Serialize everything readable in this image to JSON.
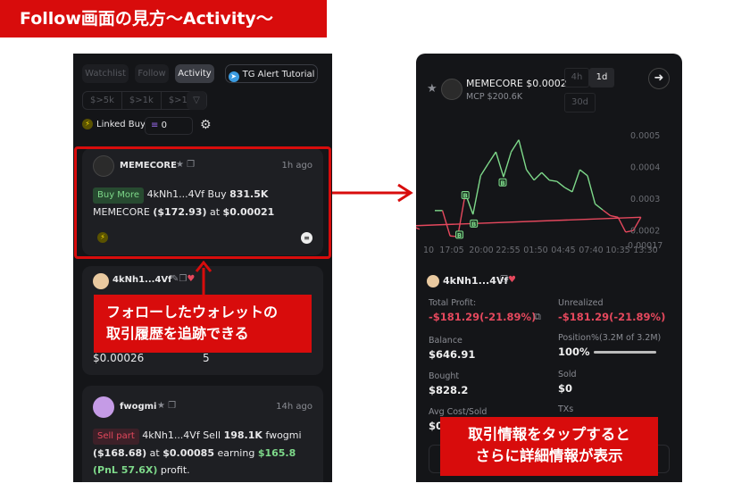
{
  "banner": {
    "title": "Follow画面の見方〜Activity〜"
  },
  "left": {
    "tabs": [
      {
        "label": "Watchlist"
      },
      {
        "label": "Follow"
      },
      {
        "label": "Activity",
        "active": true
      }
    ],
    "tg_button": "TG Alert Tutorial",
    "filters": [
      "$>5k",
      "$>1k",
      "$>100"
    ],
    "linked_buy": "Linked Buy",
    "amount_value": "0",
    "cards": [
      {
        "token": "MEMECORE",
        "time": "1h ago",
        "badge": "Buy More",
        "wallet": "4kNh1...4Vf",
        "action": "Buy",
        "amount": "831.5K",
        "token_sym": "MEMECORE",
        "usd": "($172.93)",
        "at": "at",
        "price": "$0.00021"
      },
      {
        "wallet": "4kNh1...4Vf",
        "price": "$0.00026",
        "count": "5"
      },
      {
        "token": "fwogmi",
        "time": "14h ago",
        "badge": "Sell part",
        "wallet": "4kNh1...4Vf",
        "action": "Sell",
        "amount": "198.1K",
        "token_sym": "fwogmi",
        "usd": "($168.68)",
        "at": "at",
        "price": "$0.00085",
        "earning": "earning",
        "profit": "$165.8 (PnL 57.6X)",
        "suffix": "profit."
      }
    ],
    "callout": [
      "フォローしたウォレットの",
      "取引履歴を追跡できる"
    ]
  },
  "right": {
    "token_title": "MEMECORE $0.0002",
    "mcp": "MCP $200.6K",
    "timeframes": [
      "4h",
      "1d",
      "30d"
    ],
    "active_timeframe": "1d",
    "wallet": "4kNh1...4Vf",
    "stats": {
      "total_profit_label": "Total Profit:",
      "total_profit": "-$181.29(-21.89%)",
      "unrealized_label": "Unrealized",
      "unrealized": "-$181.29(-21.89%)",
      "balance_label": "Balance",
      "balance": "$646.91",
      "position_label": "Position%(3.2M of 3.2M)",
      "position": "100%",
      "position_fraction": 1.0,
      "bought_label": "Bought",
      "bought": "$828.2",
      "sold_label": "Sold",
      "sold": "$0",
      "avg_label": "Avg Cost/Sold",
      "avg": "$0",
      "txs_label": "TXs"
    },
    "callout": [
      "取引情報をタップすると",
      "さらに詳細情報が表示"
    ]
  },
  "colors": {
    "accent_red": "#d80c0c",
    "up": "#7ed98a",
    "down": "#e5485d",
    "panel": "#141518"
  },
  "chart_data": {
    "type": "line",
    "y_ticks": [
      "0.0005",
      "0.0004",
      "0.0003",
      "0.0002",
      "0.00017"
    ],
    "x_ticks": [
      "10",
      "17:05",
      "20:00",
      "22:55",
      "01:50",
      "04:45",
      "07:40",
      "10:35",
      "13:30"
    ],
    "ylim": [
      0.00015,
      0.00055
    ],
    "points": [
      [
        "15:25",
        0.000261
      ],
      [
        "16:10",
        0.000261
      ],
      [
        "16:55",
        0.000181
      ],
      [
        "17:40",
        0.000179
      ],
      [
        "18:25",
        0.000315
      ],
      [
        "19:10",
        0.000249
      ],
      [
        "19:55",
        0.000371
      ],
      [
        "20:40",
        0.000409
      ],
      [
        "21:25",
        0.000446
      ],
      [
        "22:10",
        0.000367
      ],
      [
        "22:55",
        0.000446
      ],
      [
        "23:40",
        0.000484
      ],
      [
        "00:25",
        0.00039
      ],
      [
        "01:10",
        0.000357
      ],
      [
        "01:55",
        0.000381
      ],
      [
        "02:40",
        0.000357
      ],
      [
        "03:25",
        0.000353
      ],
      [
        "04:10",
        0.000334
      ],
      [
        "04:55",
        0.00032
      ],
      [
        "05:40",
        0.00039
      ],
      [
        "06:25",
        0.000371
      ],
      [
        "07:10",
        0.000282
      ],
      [
        "07:55",
        0.000263
      ],
      [
        "08:40",
        0.000245
      ],
      [
        "09:25",
        0.00024
      ],
      [
        "10:10",
        0.000193
      ],
      [
        "10:55",
        0.000198
      ],
      [
        "11:40",
        0.00024
      ],
      [
        "12:25",
        0.000212
      ],
      [
        "13:10",
        0.000212
      ],
      [
        "13:55",
        0.000202
      ]
    ],
    "buy_markers": [
      [
        "17:50",
        0.000185
      ],
      [
        "18:25",
        0.00031
      ],
      [
        "19:15",
        0.00022
      ],
      [
        "22:05",
        0.00035
      ],
      [
        "12:05",
        0.000195
      ]
    ],
    "marker_label": "B"
  }
}
